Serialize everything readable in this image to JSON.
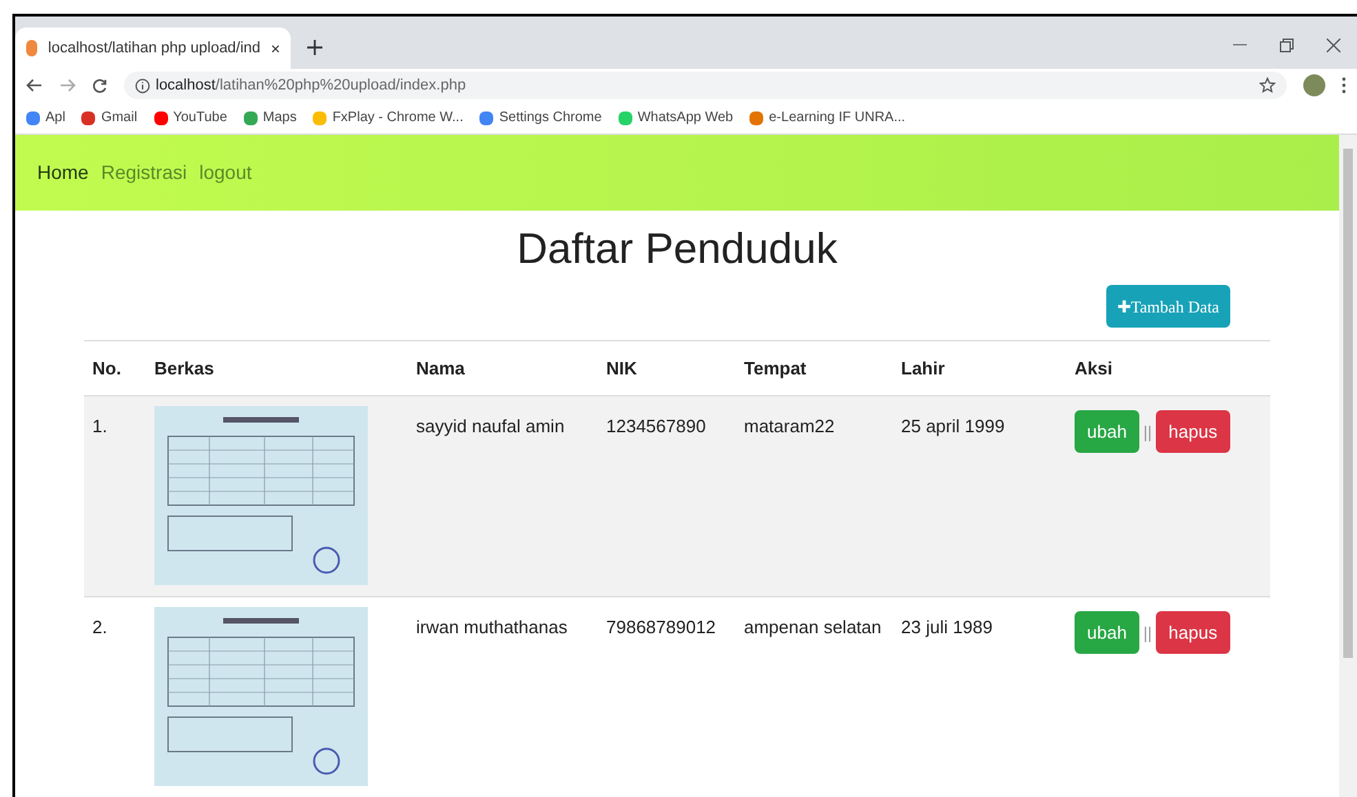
{
  "browser": {
    "tab_title": "localhost/latihan php upload/ind",
    "url_host": "localhost",
    "url_path": "/latihan%20php%20upload/index.php",
    "bookmarks": [
      {
        "label": "Apl",
        "color": "#4285f4"
      },
      {
        "label": "Gmail",
        "color": "#d93025"
      },
      {
        "label": "YouTube",
        "color": "#ff0000"
      },
      {
        "label": "Maps",
        "color": "#34a853"
      },
      {
        "label": "FxPlay - Chrome W...",
        "color": "#fbbc04"
      },
      {
        "label": "Settings Chrome",
        "color": "#4285f4"
      },
      {
        "label": "WhatsApp Web",
        "color": "#25d366"
      },
      {
        "label": "e-Learning IF UNRA...",
        "color": "#e37400"
      }
    ]
  },
  "nav": [
    {
      "label": "Home",
      "selected": true
    },
    {
      "label": "Registrasi",
      "selected": false
    },
    {
      "label": "logout",
      "selected": false
    }
  ],
  "heading": "Daftar Penduduk",
  "add_button": {
    "icon": "✚",
    "label": "Tambah Data"
  },
  "table": {
    "columns": [
      "No.",
      "Berkas",
      "Nama",
      "NIK",
      "Tempat",
      "Lahir",
      "Aksi"
    ],
    "rows": [
      {
        "no": "1.",
        "nama": "sayyid naufal amin",
        "nik": "1234567890",
        "tempat": "mataram22",
        "lahir": "25 april 1999",
        "edit": "ubah",
        "sep": "||",
        "delete": "hapus"
      },
      {
        "no": "2.",
        "nama": "irwan muthathanas",
        "nik": "79868789012",
        "tempat": "ampenan selatan",
        "lahir": "23 juli 1989",
        "edit": "ubah",
        "sep": "||",
        "delete": "hapus"
      }
    ]
  }
}
